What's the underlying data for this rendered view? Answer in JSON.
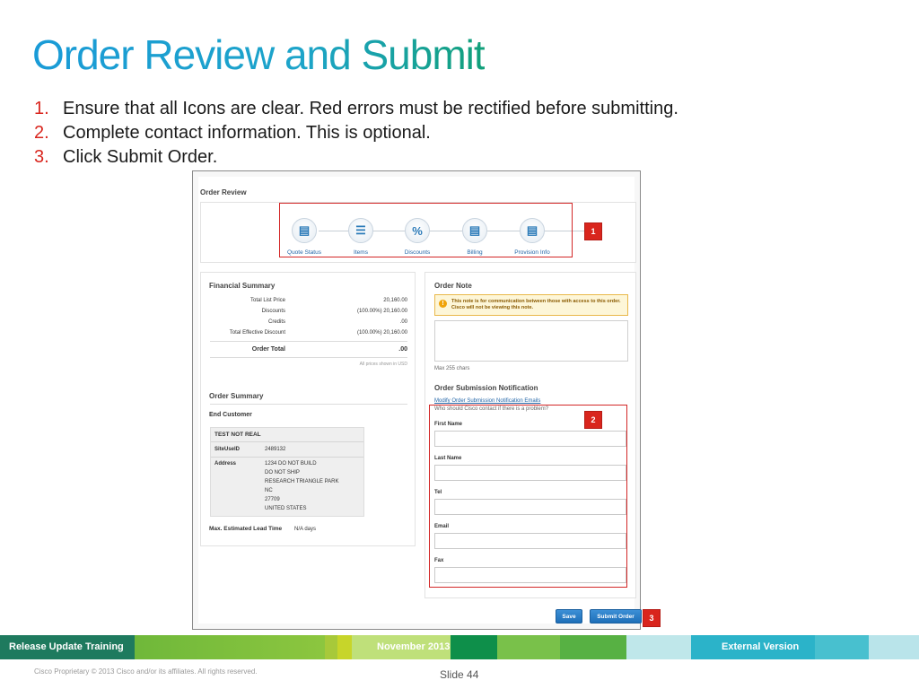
{
  "slide": {
    "title": "Order Review and Submit",
    "steps": [
      {
        "num": "1.",
        "text": "Ensure that all Icons are clear. Red errors must be rectified before submitting."
      },
      {
        "num": "2.",
        "text": "Complete contact information.  This is optional."
      },
      {
        "num": "3.",
        "text": "Click Submit Order."
      }
    ],
    "badges": [
      "1",
      "2",
      "3"
    ]
  },
  "screen": {
    "order_review_title": "Order Review",
    "icons": [
      {
        "label": "Quote Status",
        "icon": "document-icon",
        "glyph": "▤"
      },
      {
        "label": "Items",
        "icon": "list-icon",
        "glyph": "☰"
      },
      {
        "label": "Discounts",
        "icon": "percent-icon",
        "glyph": "%"
      },
      {
        "label": "Billing",
        "icon": "billing-icon",
        "glyph": "▤"
      },
      {
        "label": "Provision Info",
        "icon": "provision-icon",
        "glyph": "▤"
      }
    ],
    "financial": {
      "title": "Financial Summary",
      "rows": [
        {
          "label": "Total List Price",
          "value": "20,160.00"
        },
        {
          "label": "Discounts",
          "value": "(100.00%) 20,160.00"
        },
        {
          "label": "Credits",
          "value": ".00"
        },
        {
          "label": "Total Effective Discount",
          "value": "(100.00%) 20,160.00"
        }
      ],
      "total_label": "Order Total",
      "total_value": ".00",
      "currency_note": "All prices shown in USD"
    },
    "order_summary": {
      "title": "Order Summary",
      "end_customer_label": "End Customer",
      "customer_name": "TEST NOT REAL",
      "site_label": "SiteUseID",
      "site_value": "2489132",
      "address_label": "Address",
      "address_lines": [
        "1234 DO NOT BUILD",
        "DO NOT SHIP",
        "RESEARCH TRIANGLE PARK",
        "NC",
        "27709",
        "UNITED STATES"
      ],
      "lead_time_label": "Max. Estimated Lead Time",
      "lead_time_value": "N/A days"
    },
    "order_note": {
      "title": "Order Note",
      "warning": "This note is for communication between those with access to this order. Cisco will not be viewing this note.",
      "max_chars": "Max 255 chars"
    },
    "notification": {
      "title": "Order Submission Notification",
      "modify_link": "Modify Order Submission Notification Emails",
      "question": "Who should Cisco contact if there is a problem?",
      "fields": [
        "First Name",
        "Last Name",
        "Tel",
        "Email",
        "Fax"
      ]
    },
    "buttons": {
      "save": "Save",
      "submit": "Submit Order"
    }
  },
  "footer": {
    "left": "Release Update Training",
    "center": "November 2013",
    "right": "External Version",
    "copyright": "Cisco Proprietary © 2013 Cisco and/or its affiliates. All rights reserved.",
    "slide_label": "Slide 44"
  },
  "colors": {
    "title_gradient_start": "#1a9bd7",
    "title_gradient_end": "#12a07a",
    "step_number": "#d9251d",
    "badge": "#d9251d",
    "button": "#1e6fb8",
    "link": "#2366a8"
  }
}
